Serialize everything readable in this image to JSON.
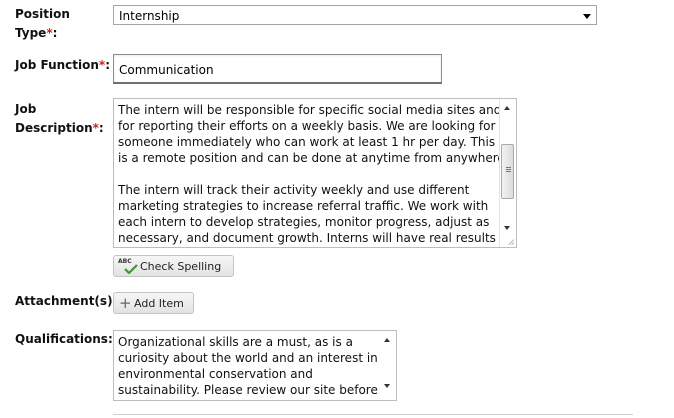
{
  "form": {
    "position_type": {
      "label_line1": "Position",
      "label_line2": "Type",
      "required": "*",
      "colon": ":",
      "value": "Internship"
    },
    "job_function": {
      "label": "Job Function",
      "required": "*",
      "colon": ":",
      "value": "Communication"
    },
    "job_description": {
      "label_line1": "Job",
      "label_line2": "Description",
      "required": "*",
      "colon": ":",
      "lines": [
        "The intern will be responsible for specific social media sites and",
        "for reporting their efforts on a weekly basis. We are looking for",
        "someone immediately who can work at least 1 hr per day. This",
        "is a remote position and can be done at anytime from anywhere.",
        "",
        "The intern will track their activity weekly and use different",
        "marketing strategies to increase referral traffic. We work with",
        "each intern to develop strategies, monitor progress, adjust as",
        "necessary, and document growth. Interns will have real results to"
      ]
    },
    "check_spelling": {
      "icon_text": "ABC",
      "label": "Check Spelling"
    },
    "attachments": {
      "label": "Attachment(s):",
      "add_label": "Add Item",
      "add_icon": "+"
    },
    "qualifications": {
      "label": "Qualifications:",
      "lines": [
        "Organizational skills are a must, as is  a",
        "curiosity about the world and an interest in",
        "environmental conservation and",
        "sustainability. Please review our site before"
      ]
    }
  }
}
